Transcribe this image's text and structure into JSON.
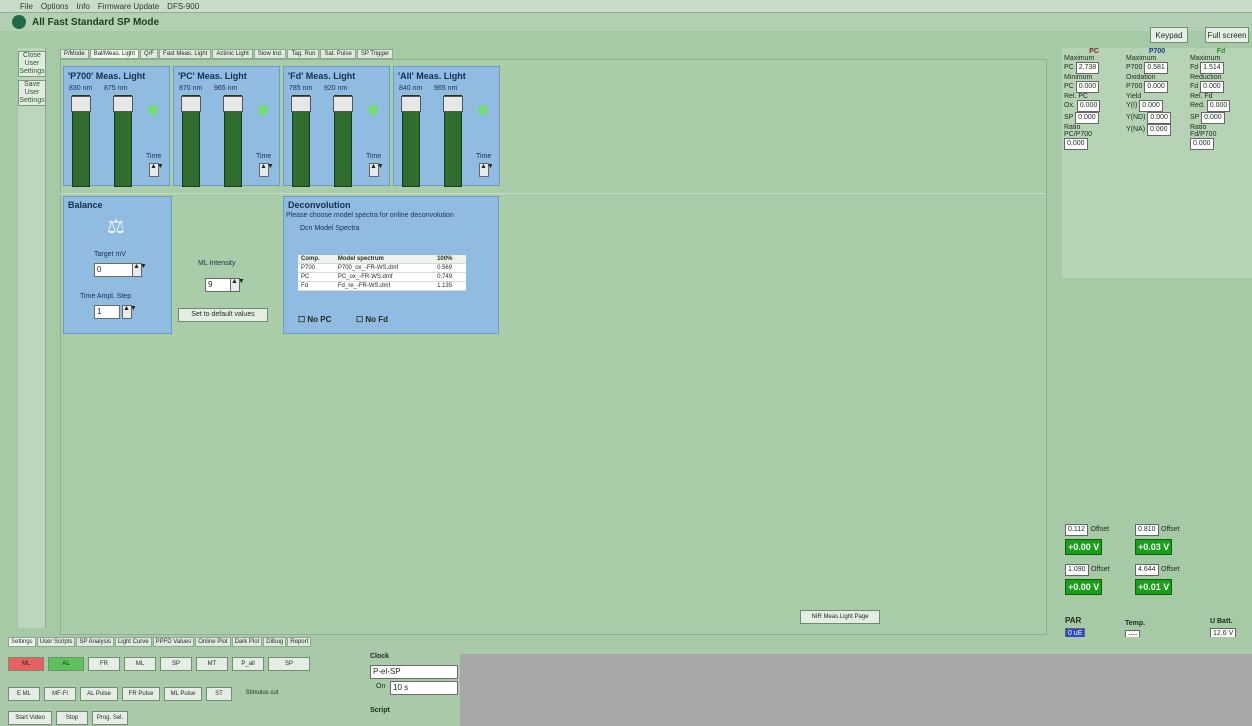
{
  "menubar": {
    "items": [
      "File",
      "Options",
      "Info",
      "Firmware Update",
      "DFS-900"
    ]
  },
  "window": {
    "title": "All Fast  Standard SP Mode"
  },
  "topbuttons": {
    "keypad": "Keypad",
    "fullscreen": "Full screen"
  },
  "side": {
    "close_user": "Close User Settings",
    "save_user": "Save User Settings"
  },
  "tabs": [
    "P/Mode",
    "Bal/Meas. Light",
    "Q/F",
    "Fast Meas. Light",
    "Actinic Light",
    "Slow Ind.",
    "Tag. Run",
    "Sat. Pulse",
    "SP Trigger"
  ],
  "meas": [
    {
      "title": "'P700' Meas. Light",
      "w1": "830 nm",
      "w2": "875 nm",
      "time": "Time"
    },
    {
      "title": "'PC' Meas. Light",
      "w1": "870 nm",
      "w2": "965 nm",
      "time": "Time"
    },
    {
      "title": "'Fd' Meas. Light",
      "w1": "785 nm",
      "w2": "920 nm",
      "time": "Time"
    },
    {
      "title": "'All' Meas. Light",
      "w1": "840 nm",
      "w2": "965 nm",
      "time": "Time"
    }
  ],
  "balance": {
    "title": "Balance",
    "target_label": "Target mV",
    "target_value": "0",
    "tas_label": "Time Ampl. Step",
    "tas_value": "1"
  },
  "ml": {
    "label": "ML Intensity",
    "value": "9",
    "default_btn": "Set to default values"
  },
  "deconv": {
    "title": "Deconvolution",
    "hint": "Please choose model spectra for online deconvolution",
    "subtitle": "Dcn Model Spectra",
    "headers": [
      "Comp.",
      "Model spectrum",
      "100%"
    ],
    "rows": [
      [
        "P700",
        "P700_ox_-FR-WS.dmf",
        "0.569"
      ],
      [
        "PC",
        "PC_ox_-FR-WS.dmf",
        "0.749"
      ],
      [
        "Fd",
        "Fd_re_-FR-WS.dmf",
        "1.135"
      ]
    ],
    "no_pc": "No PC",
    "no_fd": "No Fd"
  },
  "right": {
    "cols": [
      {
        "hd": "PC",
        "max_label": "Maximum",
        "max_name": "PC",
        "max_val": "2.738",
        "min_label": "Minimum",
        "min_name": "PC",
        "min_val": "0.000",
        "rel_label": "Rel. PC",
        "r1n": "Ox.",
        "r1v": "0.000",
        "r2n": "SP",
        "r2v": "0.000",
        "ratio_label": "Ratio",
        "ratio_name": "PC/P700",
        "ratio_val": "0.000"
      },
      {
        "hd": "P700",
        "max_label": "Maximum",
        "max_name": "P700",
        "max_val": "0.581",
        "min_label": "Oxidation",
        "min_name": "P700",
        "min_val": "0.000",
        "rel_label": "Yield",
        "r1n": "Y(I)",
        "r1v": "0.000",
        "r2n": "Y(ND)",
        "r2v": "0.000",
        "ratio_label": "",
        "ratio_name": "Y(NA)",
        "ratio_val": "0.000"
      },
      {
        "hd": "Fd",
        "max_label": "Maximum",
        "max_name": "Fd",
        "max_val": "1.514",
        "min_label": "Reduction",
        "min_name": "Fd",
        "min_val": "0.000",
        "rel_label": "Rel. Fd",
        "r1n": "Red.",
        "r1v": "0.000",
        "r2n": "SP",
        "r2v": "0.000",
        "ratio_label": "Ratio",
        "ratio_name": "Fd/P700",
        "ratio_val": "0.000"
      }
    ],
    "offsets": [
      {
        "val": "0.112",
        "label": "Offset",
        "volt": "+0.00 V"
      },
      {
        "val": "0.810",
        "label": "Offset",
        "volt": "+0.03 V"
      },
      {
        "val": "1.090",
        "label": "Offset",
        "volt": "+0.00 V"
      },
      {
        "val": "4.644",
        "label": "Offset",
        "volt": "+0.01 V"
      }
    ],
    "par_label": "PAR",
    "par_val": "0 uE",
    "temp_label": "Temp.",
    "temp_val": "----",
    "ubatt_label": "U Batt.",
    "ubatt_val": "12.6 V",
    "fr_btn": "NIR Meas.Light Page"
  },
  "bottom": {
    "tabs": [
      "Settings",
      "User Scripts",
      "SP Analysis",
      "Light Curve",
      "PPFD Values",
      "Online Plot",
      "Dark Plot",
      "Dilbug",
      "Report"
    ],
    "row1": [
      "ML",
      "AL",
      "FR",
      "ML",
      "SP",
      "MT",
      "P_all",
      "SP"
    ],
    "row2": [
      "E ML",
      "MF-Fl",
      "AL Pulse",
      "FR Pulse",
      "ML Pulse",
      "ST",
      "Stimulus cut"
    ],
    "row3": [
      "Start Video",
      "Stop",
      "Prog. Sel."
    ],
    "clock_label": "Clock",
    "clock_val": "P-el-SP",
    "on_label": "On",
    "on_val": "10 s",
    "script_label": "Script"
  }
}
